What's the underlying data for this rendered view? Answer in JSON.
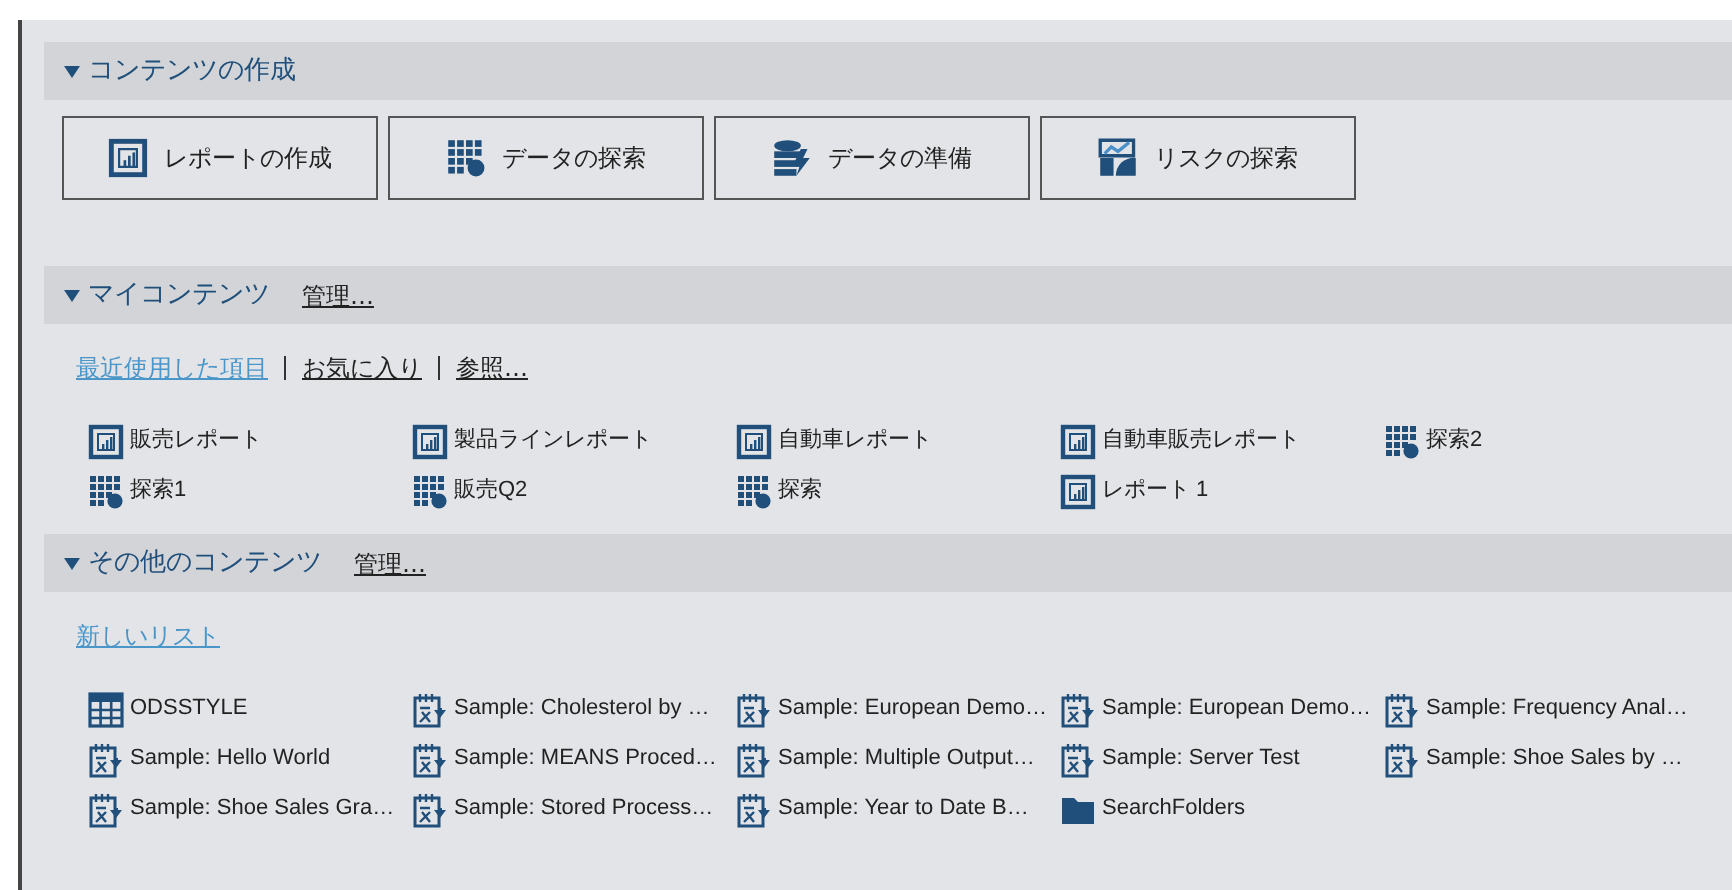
{
  "sections": [
    {
      "title": "コンテンツの作成",
      "expanded": true,
      "buttons": [
        {
          "label": "レポートの作成",
          "kind": "report"
        },
        {
          "label": "データの探索",
          "kind": "explore"
        },
        {
          "label": "データの準備",
          "kind": "prep"
        },
        {
          "label": "リスクの探索",
          "kind": "risk"
        }
      ]
    },
    {
      "title": "マイコンテンツ",
      "expanded": true,
      "manage": "管理…",
      "links": [
        {
          "label": "最近使用した項目",
          "selected": true
        },
        {
          "label": "お気に入り",
          "selected": false
        },
        {
          "label": "参照…",
          "selected": false
        }
      ],
      "items": [
        {
          "label": "販売レポート",
          "kind": "report"
        },
        {
          "label": "製品ラインレポート",
          "kind": "report"
        },
        {
          "label": "自動車レポート",
          "kind": "report"
        },
        {
          "label": "自動車販売レポート",
          "kind": "report"
        },
        {
          "label": "探索2",
          "kind": "explore"
        },
        {
          "label": "探索1",
          "kind": "explore"
        },
        {
          "label": "販売Q2",
          "kind": "explore"
        },
        {
          "label": "探索",
          "kind": "explore"
        },
        {
          "label": "レポート 1",
          "kind": "report"
        }
      ]
    },
    {
      "title": "その他のコンテンツ",
      "expanded": true,
      "manage": "管理…",
      "links": [
        {
          "label": "新しいリスト",
          "selected": true
        }
      ],
      "items": [
        {
          "label": "ODSSTYLE",
          "kind": "table"
        },
        {
          "label": "Sample: Cholesterol by …",
          "kind": "process"
        },
        {
          "label": "Sample: European Demo…",
          "kind": "process"
        },
        {
          "label": "Sample: European Demo…",
          "kind": "process"
        },
        {
          "label": "Sample: Frequency Anal…",
          "kind": "process"
        },
        {
          "label": "Sample: Hello World",
          "kind": "process"
        },
        {
          "label": "Sample: MEANS Proced…",
          "kind": "process"
        },
        {
          "label": "Sample: Multiple Output…",
          "kind": "process"
        },
        {
          "label": "Sample: Server Test",
          "kind": "process"
        },
        {
          "label": "Sample: Shoe Sales by …",
          "kind": "process"
        },
        {
          "label": "Sample: Shoe Sales Gra…",
          "kind": "process"
        },
        {
          "label": "Sample: Stored Process…",
          "kind": "process"
        },
        {
          "label": "Sample: Year to Date B…",
          "kind": "process"
        },
        {
          "label": "SearchFolders",
          "kind": "folder"
        }
      ]
    }
  ]
}
